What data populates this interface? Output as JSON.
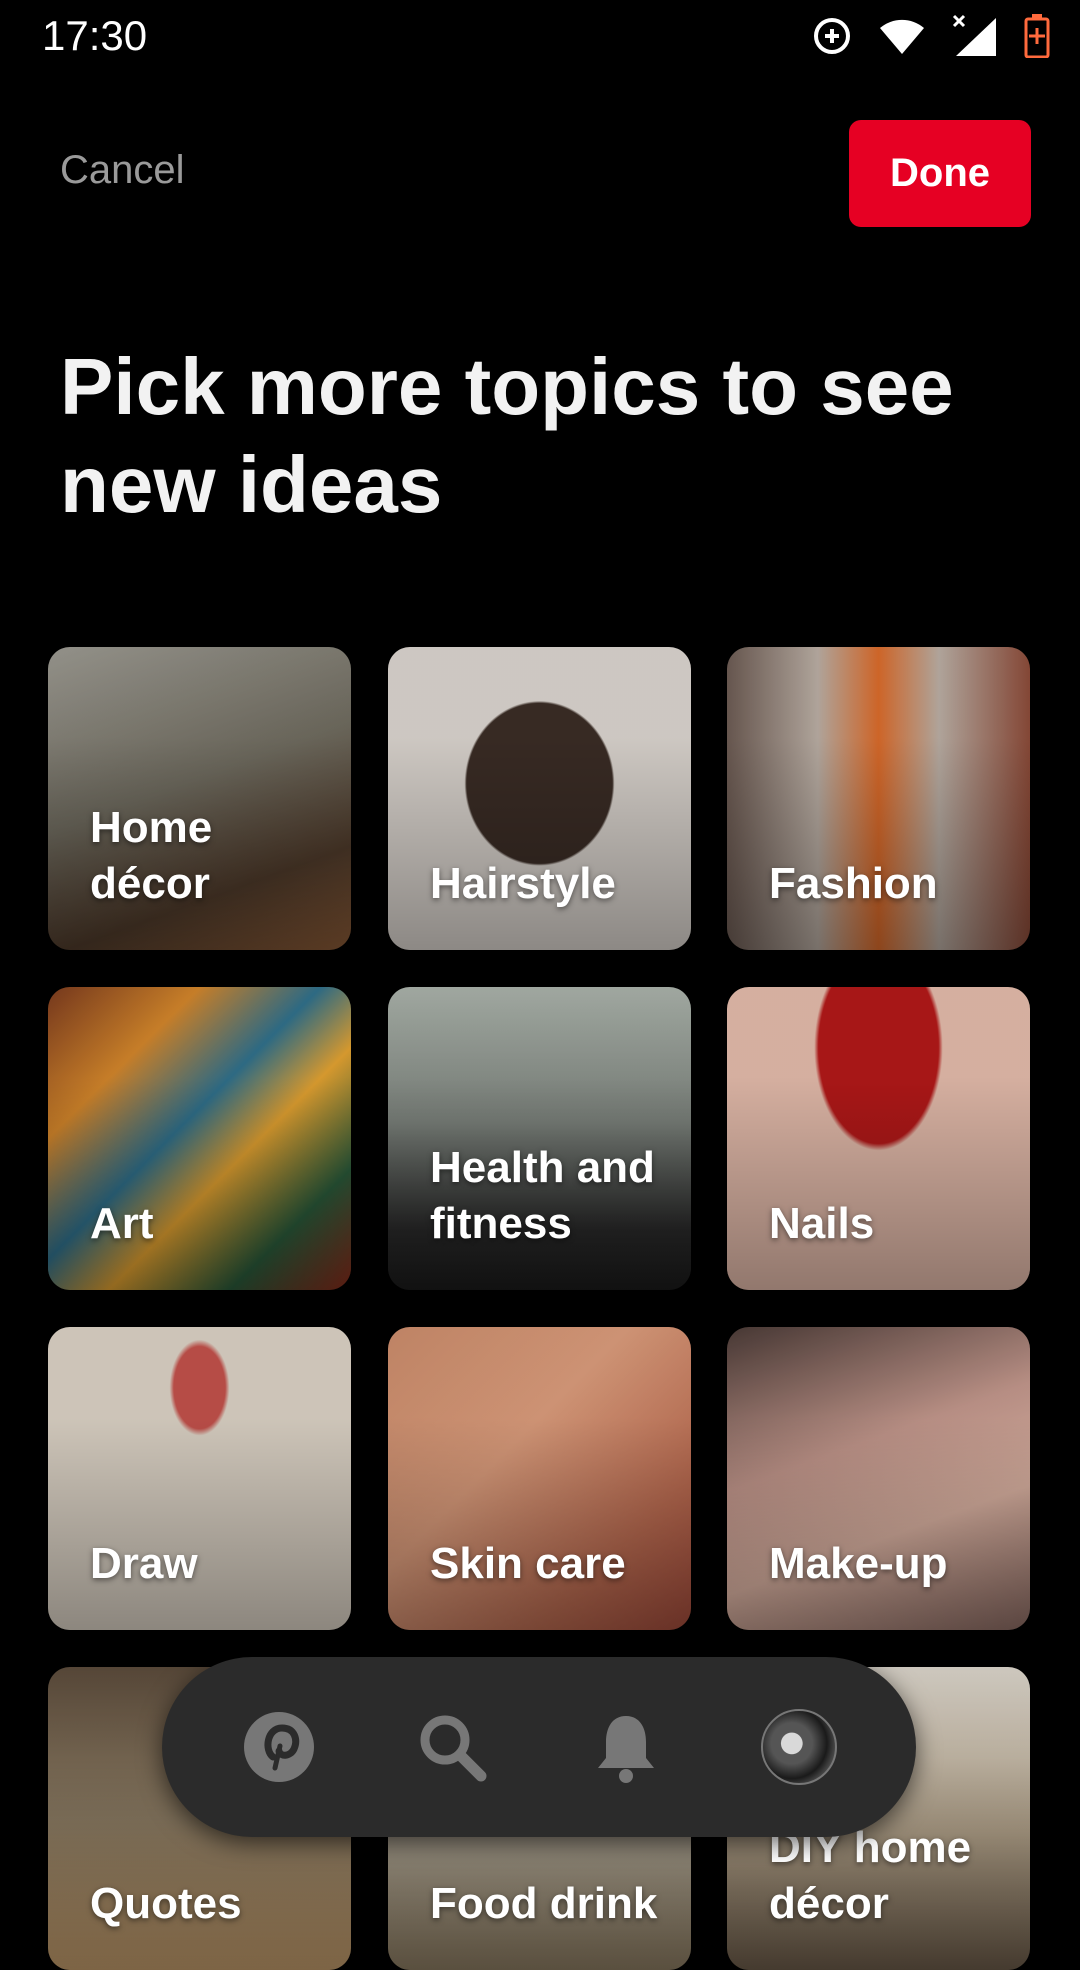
{
  "status_bar": {
    "time": "17:30",
    "icons": [
      "sync-icon",
      "wifi-icon",
      "cell-signal-icon",
      "battery-charging-icon"
    ]
  },
  "header": {
    "cancel_label": "Cancel",
    "done_label": "Done"
  },
  "title": "Pick more topics to see new ideas",
  "topics": [
    {
      "label": "Home décor"
    },
    {
      "label": "Hairstyle"
    },
    {
      "label": "Fashion"
    },
    {
      "label": "Art"
    },
    {
      "label": "Health and fitness"
    },
    {
      "label": "Nails"
    },
    {
      "label": "Draw"
    },
    {
      "label": "Skin care"
    },
    {
      "label": "Make-up"
    },
    {
      "label": "Quotes"
    },
    {
      "label": "Food drink"
    },
    {
      "label": "DIY home décor"
    }
  ],
  "bottom_nav": {
    "items": [
      "home-icon",
      "search-icon",
      "notifications-icon",
      "profile-avatar"
    ]
  },
  "colors": {
    "accent": "#e60023",
    "background": "#000000",
    "nav_background": "#2b2b2b"
  }
}
